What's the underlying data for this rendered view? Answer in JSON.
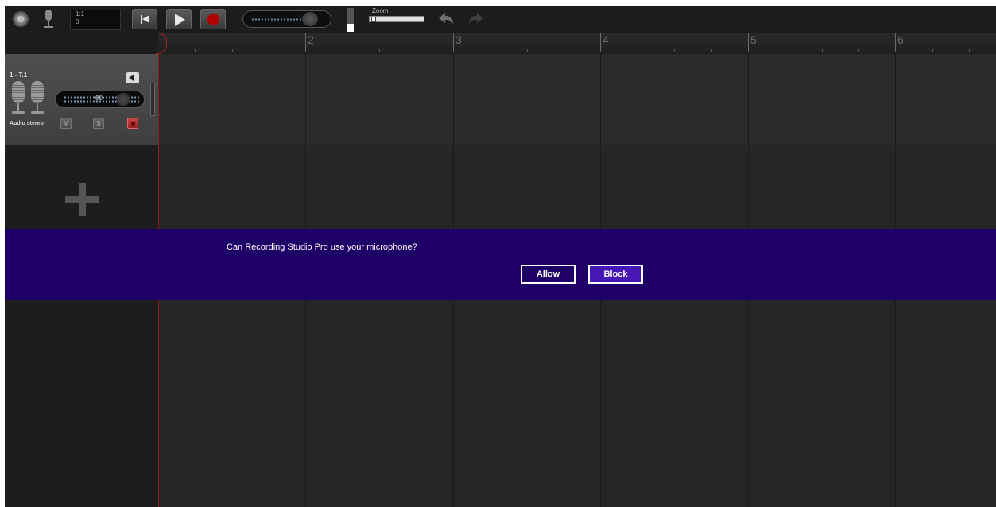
{
  "toolbar": {
    "position_bar": "1:1",
    "position_tick": "0",
    "zoom_label": "Zoom",
    "icons": [
      "gear-icon",
      "microphone-icon",
      "skip-to-start-icon",
      "play-icon",
      "record-icon",
      "undo-icon",
      "redo-icon"
    ]
  },
  "ruler": {
    "bars": [
      "2",
      "3",
      "4",
      "5",
      "6"
    ]
  },
  "track": {
    "name": "1 - T.1",
    "type": "Audio stereo",
    "pan_label": "00",
    "mute_label": "M",
    "solo_label": "S"
  },
  "permission": {
    "message": "Can Recording Studio Pro use your microphone?",
    "allow_label": "Allow",
    "block_label": "Block",
    "background_color": "#1e0066",
    "block_color": "#4617b4"
  },
  "colors": {
    "app_background": "#262626",
    "record_red": "#b30000",
    "playhead": "#8b1a1a"
  }
}
